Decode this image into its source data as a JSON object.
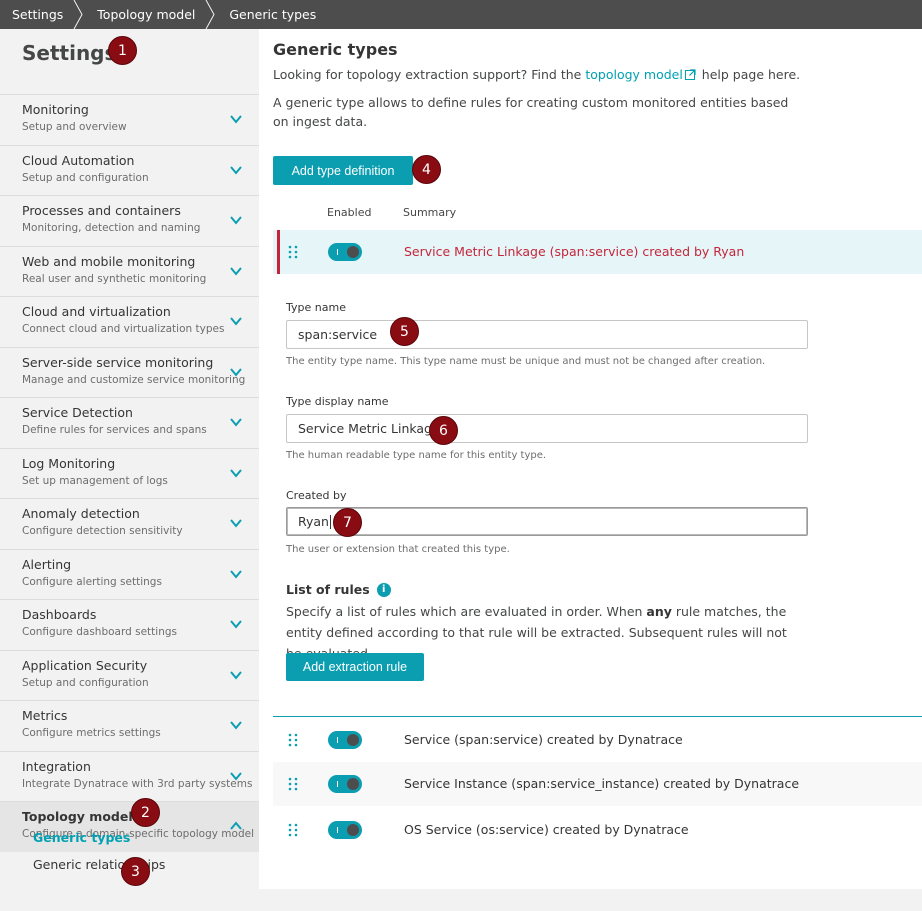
{
  "breadcrumb": [
    "Settings",
    "Topology model",
    "Generic types"
  ],
  "sidebar": {
    "title": "Settings",
    "items": [
      {
        "label": "Monitoring",
        "sub": "Setup and overview"
      },
      {
        "label": "Cloud Automation",
        "sub": "Setup and configuration"
      },
      {
        "label": "Processes and containers",
        "sub": "Monitoring, detection and naming"
      },
      {
        "label": "Web and mobile monitoring",
        "sub": "Real user and synthetic monitoring"
      },
      {
        "label": "Cloud and virtualization",
        "sub": "Connect cloud and virtualization types"
      },
      {
        "label": "Server-side service monitoring",
        "sub": "Manage and customize service monitoring"
      },
      {
        "label": "Service Detection",
        "sub": "Define rules for services and spans"
      },
      {
        "label": "Log Monitoring",
        "sub": "Set up management of logs"
      },
      {
        "label": "Anomaly detection",
        "sub": "Configure detection sensitivity"
      },
      {
        "label": "Alerting",
        "sub": "Configure alerting settings"
      },
      {
        "label": "Dashboards",
        "sub": "Configure dashboard settings"
      },
      {
        "label": "Application Security",
        "sub": "Setup and configuration"
      },
      {
        "label": "Metrics",
        "sub": "Configure metrics settings"
      },
      {
        "label": "Integration",
        "sub": "Integrate Dynatrace with 3rd party systems"
      },
      {
        "label": "Topology model",
        "sub": "Configure a domain-specific topology model"
      }
    ],
    "sub_items": [
      "Generic types",
      "Generic relationships"
    ]
  },
  "main": {
    "title": "Generic types",
    "intro_before": "Looking for topology extraction support? Find the ",
    "intro_link": "topology model",
    "intro_after": " help page here.",
    "intro2": "A generic type allows to define rules for creating custom monitored entities based on ingest data.",
    "add_type_button": "Add type definition",
    "col_enabled": "Enabled",
    "col_summary": "Summary",
    "expanded_row": {
      "summary": "Service Metric Linkage (span:service) created by Ryan",
      "enabled": true
    },
    "form": {
      "type_name_label": "Type name",
      "type_name_value": "span:service",
      "type_name_help": "The entity type name. This type name must be unique and must not be changed after creation.",
      "display_name_label": "Type display name",
      "display_name_value": "Service Metric Linkage",
      "display_name_help": "The human readable type name for this entity type.",
      "created_by_label": "Created by",
      "created_by_value": "Ryan",
      "created_by_help": "The user or extension that created this type.",
      "rules_title": "List of rules",
      "rules_desc_1": "Specify a list of rules which are evaluated in order. When ",
      "rules_desc_bold": "any",
      "rules_desc_2": " rule matches, the entity defined according to that rule will be extracted. Subsequent rules will not be evaluated.",
      "add_rule_button": "Add extraction rule"
    },
    "rows": [
      {
        "summary": "Service (span:service) created by Dynatrace",
        "enabled": true
      },
      {
        "summary": "Service Instance (span:service_instance) created by Dynatrace",
        "enabled": true
      },
      {
        "summary": "OS Service (os:service) created by Dynatrace",
        "enabled": true
      }
    ]
  },
  "markers": [
    "1",
    "2",
    "3",
    "4",
    "5",
    "6",
    "7"
  ],
  "colors": {
    "accent": "#0a9eb0",
    "error": "#c4253b",
    "marker": "#8a0c13",
    "breadcrumb_bg": "#4d4d4d"
  }
}
